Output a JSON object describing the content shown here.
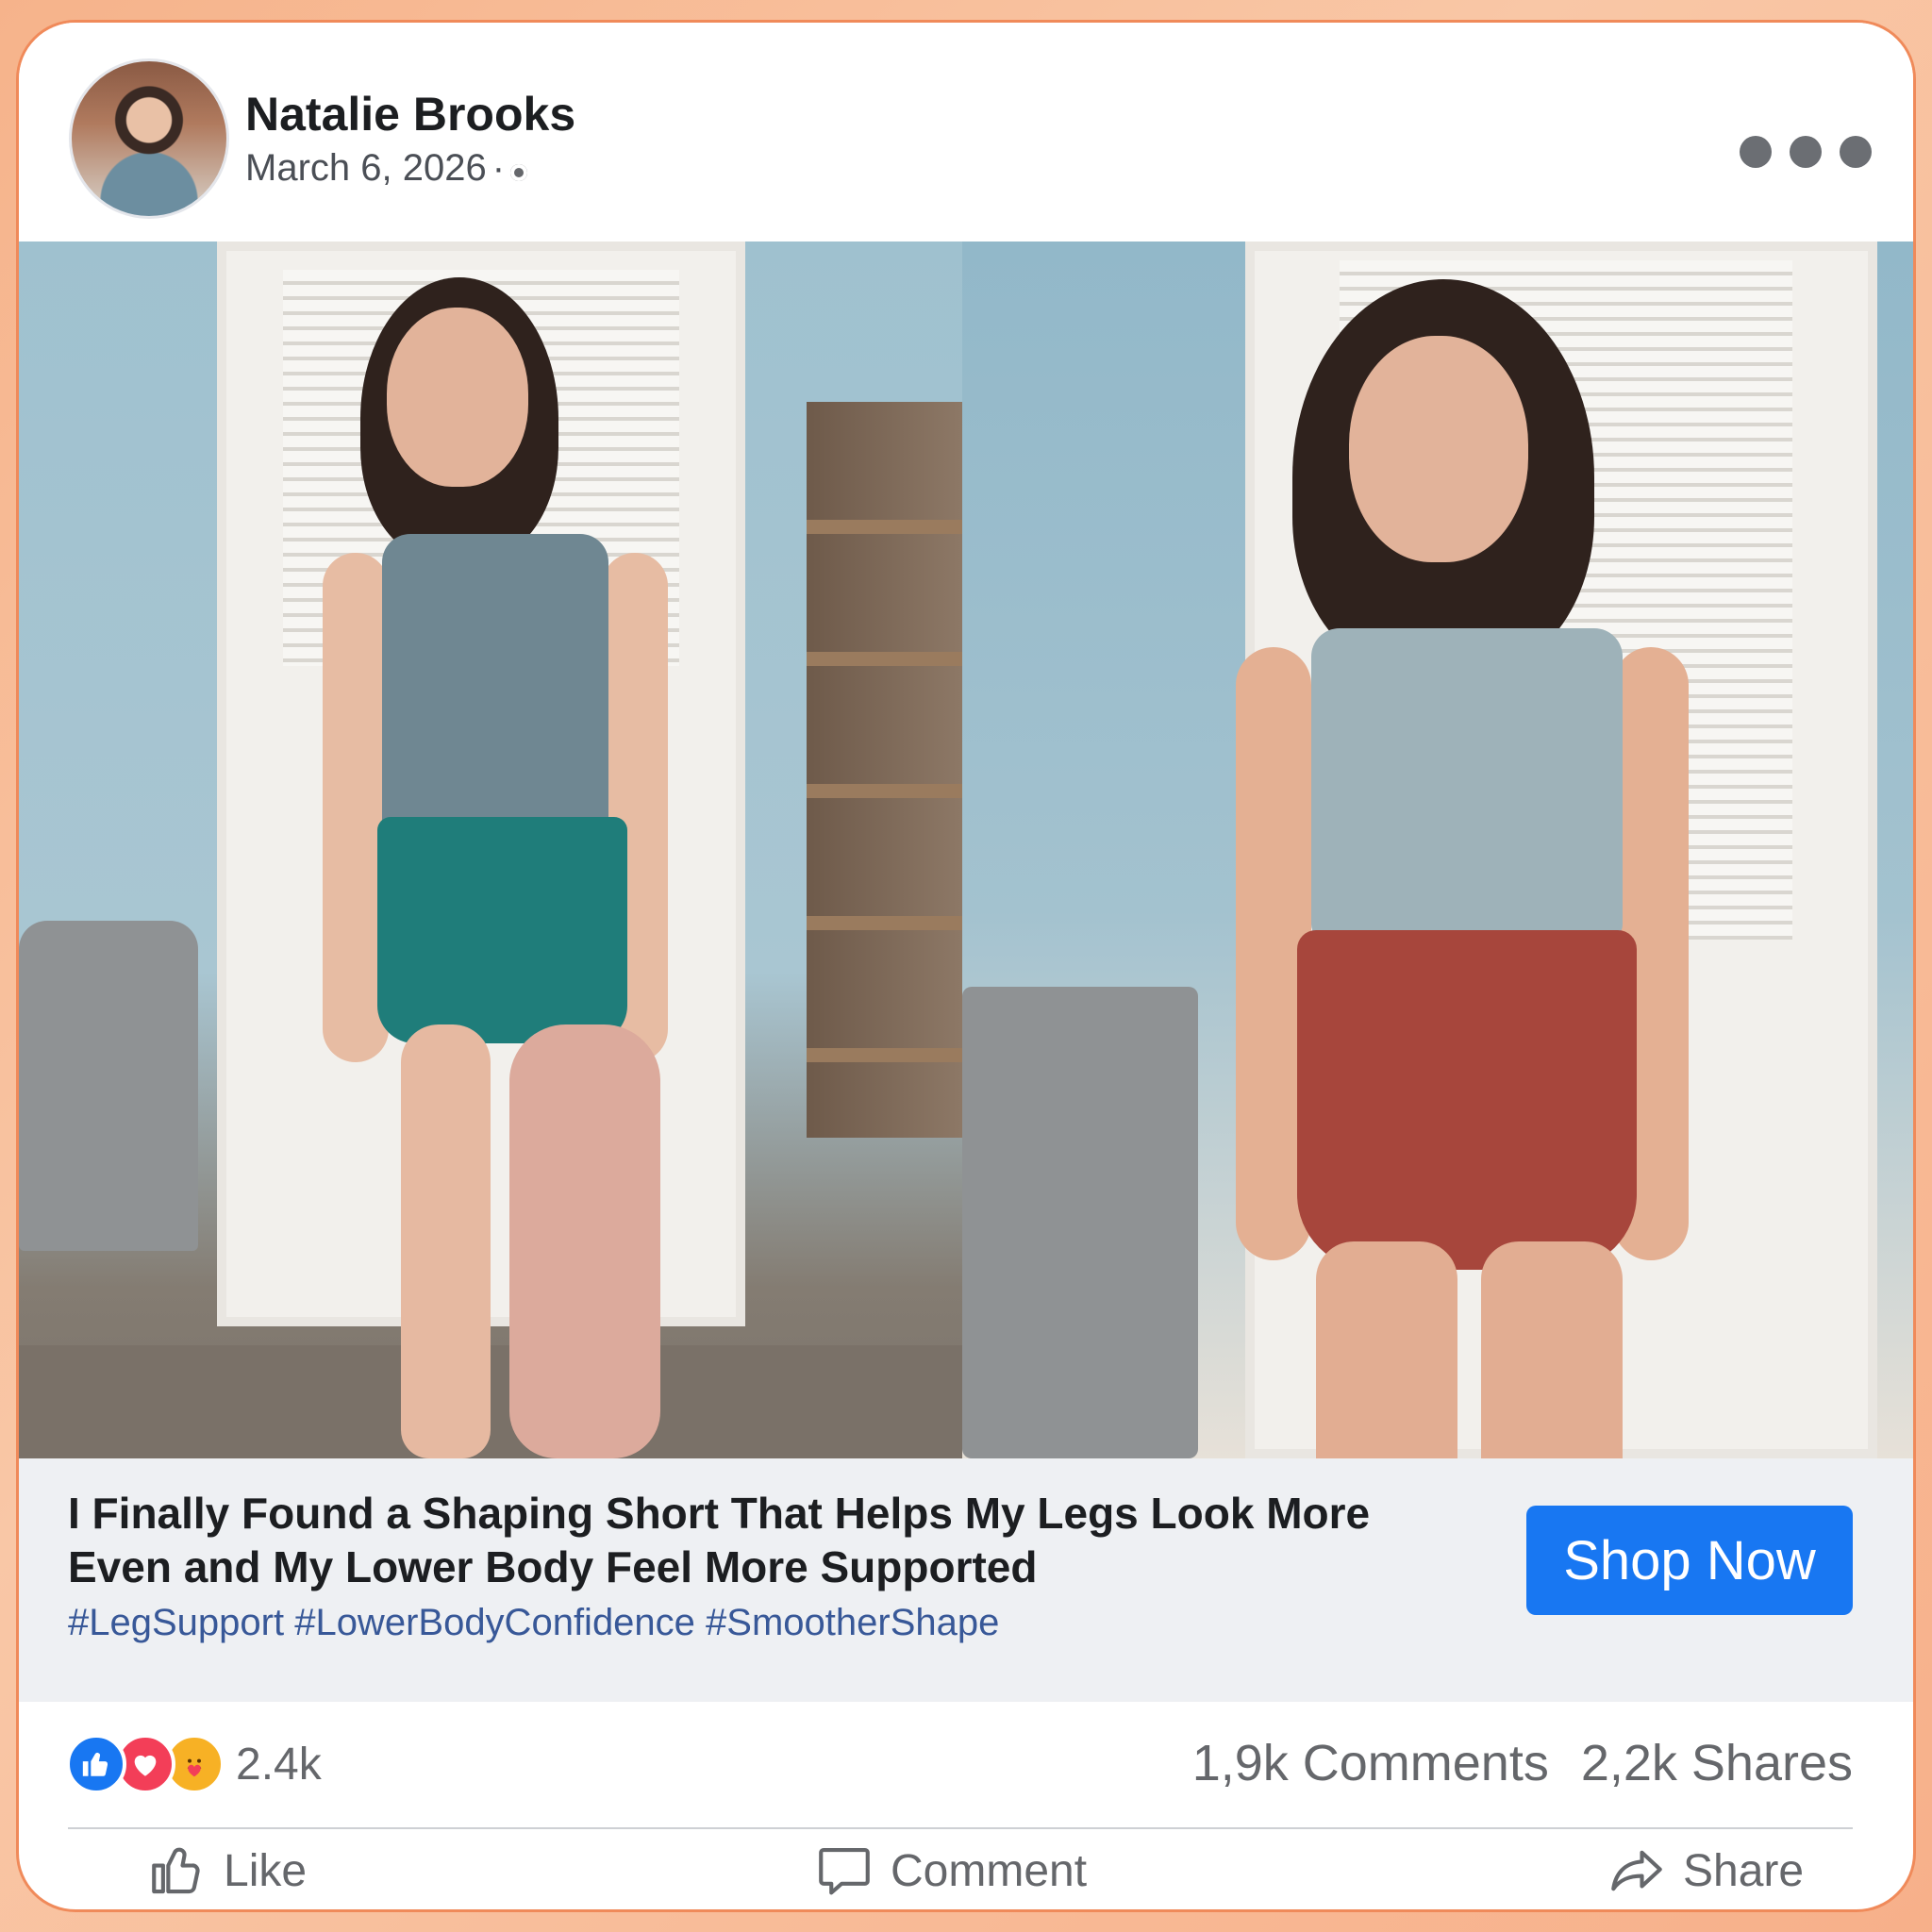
{
  "post": {
    "author": "Natalie Brooks",
    "date": "March 6, 2026",
    "date_sep": "·",
    "headline": "I Finally Found a Shaping Short That Helps My Legs Look More Even and My Lower Body Feel More Supported",
    "hashtags": "#LegSupport #LowerBodyConfidence #SmootherShape",
    "cta_label": "Shop Now"
  },
  "stats": {
    "reaction_count": "2.4k",
    "comments": "1,9k Comments",
    "shares": "2,2k Shares",
    "reaction_icons": [
      "like-icon",
      "love-icon",
      "care-icon"
    ]
  },
  "actions": {
    "like": "Like",
    "comment": "Comment",
    "share": "Share"
  },
  "colors": {
    "brand_blue": "#1877f2",
    "hashtag": "#385898",
    "love": "#f33e58",
    "care": "#f7b125"
  }
}
